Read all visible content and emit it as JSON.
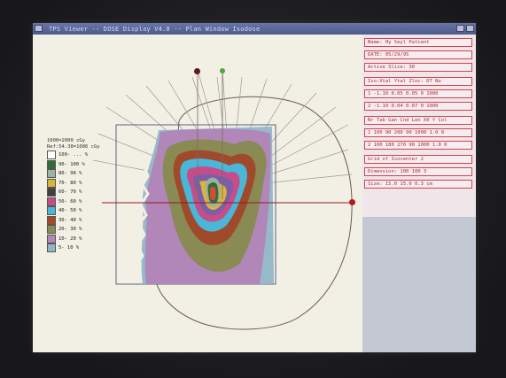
{
  "window": {
    "title": "TPS Viewer -- DOSE Display V4.0 -- Plan Window Isodose"
  },
  "legend": {
    "header_line1": "1000=2000 cGy",
    "header_line2": "Ref:54.38=1086 cGy",
    "items": [
      {
        "label": "100- ... %",
        "color": "#ffffff"
      },
      {
        "label": "90- 100 %",
        "color": "#2f6f34"
      },
      {
        "label": "80- 90 %",
        "color": "#9cb0a3"
      },
      {
        "label": "70- 80 %",
        "color": "#d9b43a"
      },
      {
        "label": "60- 70 %",
        "color": "#404040"
      },
      {
        "label": "50- 60 %",
        "color": "#c64d8a"
      },
      {
        "label": "40- 50 %",
        "color": "#49b7d8"
      },
      {
        "label": "30- 40 %",
        "color": "#a04a2c"
      },
      {
        "label": "20- 30 %",
        "color": "#8a8a55"
      },
      {
        "label": "10- 20 %",
        "color": "#b186b8"
      },
      {
        "label": "5- 10 %",
        "color": "#8fb5c8"
      }
    ]
  },
  "panel": {
    "fields": [
      "Name: Hy Seyl Patient",
      "DATE: 05/29/95",
      "Active Slice: 30",
      "Iso:Xtal Ytal Zloc: DT No",
      "1 -1.10 0.05 0.05 0 1000",
      "2 -1.10 0.04 0.07 0 1000",
      "Nr Tab Gan Cnd Len X0 Y Col",
      "1 100 90 200 90 1000 1.0 0",
      "2 100 180 270 90 1000 1.0 0",
      "Grid of Isocenter 2",
      "Dimension: 100 100 3",
      "Size: 15.0 15.0 0.3 cm"
    ]
  },
  "colors": {
    "screen": "#f2efe4",
    "panel_border": "#d2424e",
    "beam_dot_red": "#b31b1b",
    "beam_dot_green": "#4fa83a",
    "beam_dot_dark": "#5a1f1a"
  }
}
